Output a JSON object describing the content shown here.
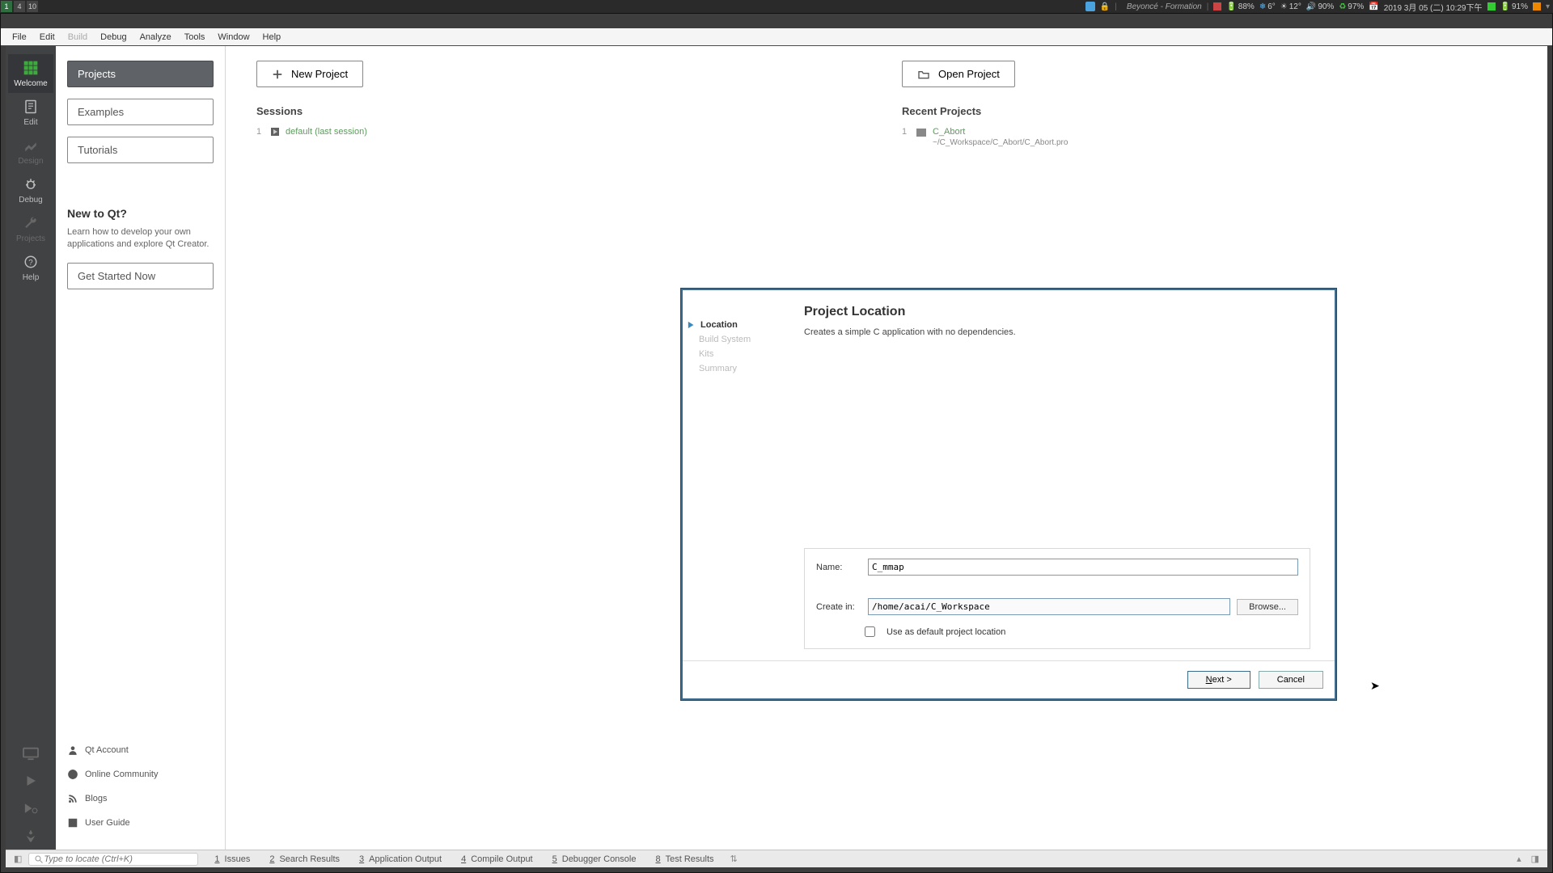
{
  "sysbar": {
    "workspaces": [
      "1",
      "4",
      "10"
    ],
    "music": "Beyoncé - Formation",
    "tray": {
      "batt1": "88%",
      "temp_low": "6°",
      "temp_hi": "12°",
      "vol": "90%",
      "recycle": "97%",
      "date": "2019 3月 05 (二) 10:29下午",
      "batt2": "91%"
    }
  },
  "menubar": [
    "File",
    "Edit",
    "Build",
    "Debug",
    "Analyze",
    "Tools",
    "Window",
    "Help"
  ],
  "lefttool": [
    {
      "id": "welcome",
      "label": "Welcome",
      "active": true
    },
    {
      "id": "edit",
      "label": "Edit"
    },
    {
      "id": "design",
      "label": "Design",
      "disabled": true
    },
    {
      "id": "debug",
      "label": "Debug"
    },
    {
      "id": "projects",
      "label": "Projects",
      "disabled": true
    },
    {
      "id": "help",
      "label": "Help"
    }
  ],
  "welcome": {
    "tabs": {
      "projects": "Projects",
      "examples": "Examples",
      "tutorials": "Tutorials"
    },
    "newto": "New to Qt?",
    "newto_desc": "Learn how to develop your own applications and explore Qt Creator.",
    "getstarted": "Get Started Now",
    "links": {
      "account": "Qt Account",
      "community": "Online Community",
      "blogs": "Blogs",
      "guide": "User Guide"
    }
  },
  "actions": {
    "newproj": "New Project",
    "openproj": "Open Project"
  },
  "sessions": {
    "heading": "Sessions",
    "items": [
      {
        "idx": "1",
        "label": "default (last session)"
      }
    ]
  },
  "recent": {
    "heading": "Recent Projects",
    "items": [
      {
        "idx": "1",
        "name": "C_Abort",
        "path": "~/C_Workspace/C_Abort/C_Abort.pro"
      }
    ]
  },
  "wizard": {
    "title": "Project Location",
    "subtitle": "Creates a simple C application with no dependencies.",
    "steps": [
      "Location",
      "Build System",
      "Kits",
      "Summary"
    ],
    "name_label": "Name:",
    "name_value": "C_mmap",
    "create_label": "Create in:",
    "create_value": "/home/acai/C_Workspace",
    "browse": "Browse...",
    "default_chk": "Use as default project location",
    "next": "Next >",
    "cancel": "Cancel"
  },
  "status": {
    "locator_ph": "Type to locate (Ctrl+K)",
    "panes": [
      {
        "n": "1",
        "label": "Issues"
      },
      {
        "n": "2",
        "label": "Search Results"
      },
      {
        "n": "3",
        "label": "Application Output"
      },
      {
        "n": "4",
        "label": "Compile Output"
      },
      {
        "n": "5",
        "label": "Debugger Console"
      },
      {
        "n": "8",
        "label": "Test Results"
      }
    ]
  }
}
